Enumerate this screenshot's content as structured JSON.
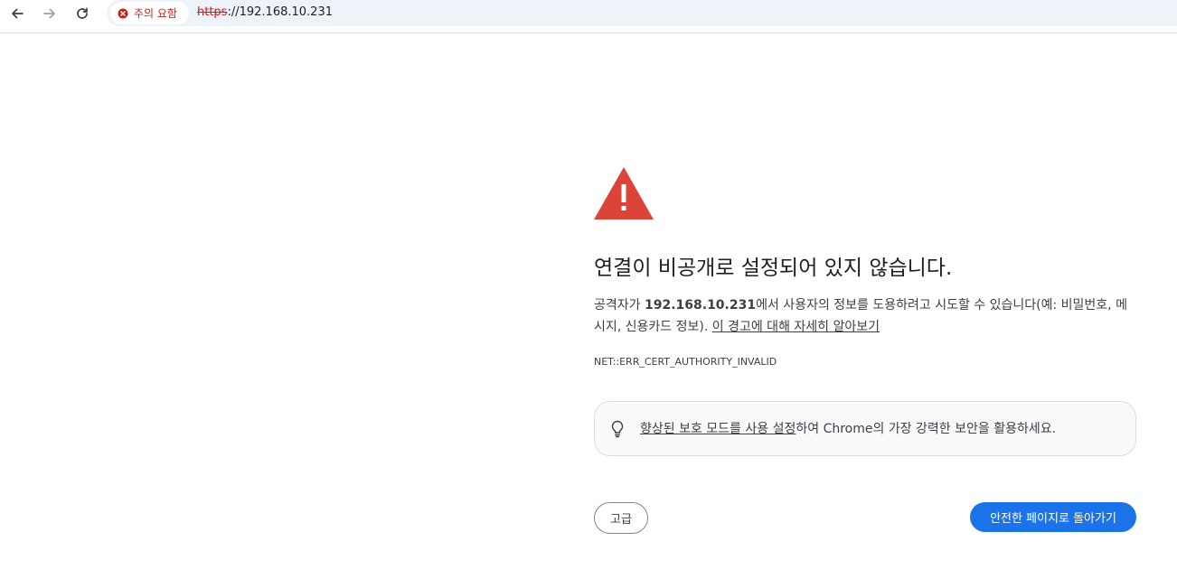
{
  "toolbar": {
    "back_icon": "arrow-left-icon",
    "forward_icon": "arrow-right-icon",
    "reload_icon": "reload-icon",
    "security_chip": {
      "icon": "error-circle-icon",
      "label": "주의 요함",
      "color": "#c5221f"
    },
    "url": {
      "scheme": "https",
      "rest": "://192.168.10.231"
    }
  },
  "interstitial": {
    "icon": "warning-triangle-icon",
    "icon_color": "#db4437",
    "heading": "연결이 비공개로 설정되어 있지 않습니다.",
    "explanation": {
      "prefix": "공격자가 ",
      "host": "192.168.10.231",
      "suffix": "에서 사용자의 정보를 도용하려고 시도할 수 있습니다(예: 비밀번호, 메시지, 신용카드 정보). ",
      "learn_more": "이 경고에 대해 자세히 알아보기"
    },
    "error_code": "NET::ERR_CERT_AUTHORITY_INVALID",
    "enhanced_protection": {
      "icon": "lightbulb-icon",
      "link": "향상된 보호 모드를 사용 설정",
      "text": "하여 Chrome의 가장 강력한 보안을 활용하세요."
    },
    "advanced_label": "고급",
    "back_to_safety_label": "안전한 페이지로 돌아가기",
    "primary_color": "#1a73e8"
  }
}
